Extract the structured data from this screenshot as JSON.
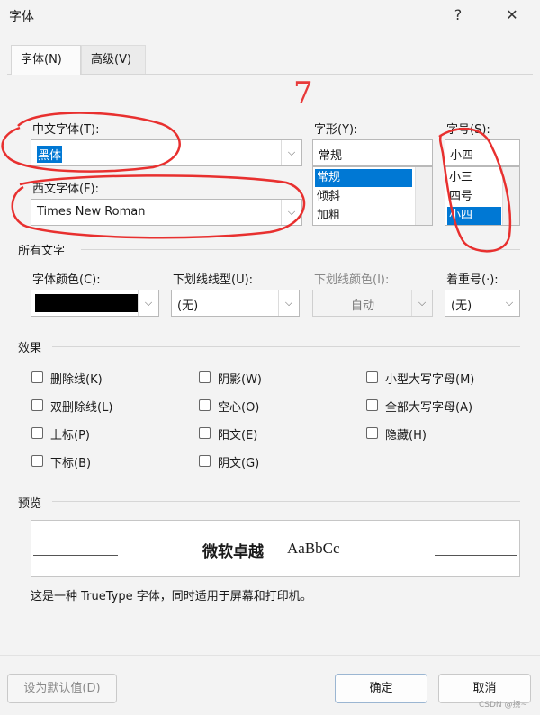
{
  "window": {
    "title": "字体",
    "help": "?",
    "close": "✕"
  },
  "tabs": [
    {
      "label": "字体(N)"
    },
    {
      "label": "高级(V)"
    }
  ],
  "annotation_number": "7",
  "fonts": {
    "chinese_label": "中文字体(T):",
    "chinese_value": "黑体",
    "western_label": "西文字体(F):",
    "western_value": "Times New Roman",
    "style_label": "字形(Y):",
    "style_value": "常规",
    "style_options": [
      "常规",
      "倾斜",
      "加粗"
    ],
    "size_label": "字号(S):",
    "size_value": "小四",
    "size_options": [
      "小三",
      "四号",
      "小四"
    ]
  },
  "all_text": {
    "section": "所有文字",
    "color_label": "字体颜色(C):",
    "color_value": "#000000",
    "underline_label": "下划线线型(U):",
    "underline_value": "(无)",
    "underline_color_label": "下划线颜色(I):",
    "underline_color_value": "自动",
    "emphasis_label": "着重号(·):",
    "emphasis_value": "(无)"
  },
  "effects": {
    "section": "效果",
    "col1": [
      "删除线(K)",
      "双删除线(L)",
      "上标(P)",
      "下标(B)"
    ],
    "col2": [
      "阴影(W)",
      "空心(O)",
      "阳文(E)",
      "阴文(G)"
    ],
    "col3": [
      "小型大写字母(M)",
      "全部大写字母(A)",
      "隐藏(H)"
    ]
  },
  "preview": {
    "section": "预览",
    "sample_cn": "微软卓越",
    "sample_en": "AaBbCc",
    "note": "这是一种 TrueType 字体，同时适用于屏幕和打印机。"
  },
  "buttons": {
    "default": "设为默认值(D)",
    "ok": "确定",
    "cancel": "取消"
  },
  "watermark": "CSDN @挠~"
}
